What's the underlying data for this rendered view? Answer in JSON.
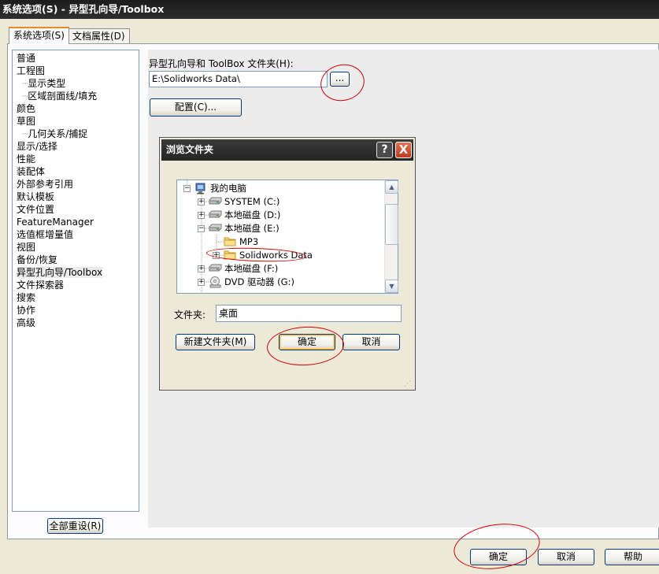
{
  "window": {
    "title": "系统选项(S) - 异型孔向导/Toolbox"
  },
  "tabs": [
    {
      "label": "系统选项(S)",
      "active": true
    },
    {
      "label": "文档属性(D)",
      "active": false
    }
  ],
  "tree": {
    "items": [
      {
        "label": "普通",
        "level": 0
      },
      {
        "label": "工程图",
        "level": 0
      },
      {
        "label": "显示类型",
        "level": 1
      },
      {
        "label": "区域剖面线/填充",
        "level": 1
      },
      {
        "label": "颜色",
        "level": 0
      },
      {
        "label": "草图",
        "level": 0
      },
      {
        "label": "几何关系/捕捉",
        "level": 1
      },
      {
        "label": "显示/选择",
        "level": 0
      },
      {
        "label": "性能",
        "level": 0
      },
      {
        "label": "装配体",
        "level": 0
      },
      {
        "label": "外部参考引用",
        "level": 0
      },
      {
        "label": "默认模板",
        "level": 0
      },
      {
        "label": "文件位置",
        "level": 0
      },
      {
        "label": "FeatureManager",
        "level": 0
      },
      {
        "label": "选值框增量值",
        "level": 0
      },
      {
        "label": "视图",
        "level": 0
      },
      {
        "label": "备份/恢复",
        "level": 0
      },
      {
        "label": "异型孔向导/Toolbox",
        "level": 0,
        "selected": true
      },
      {
        "label": "文件探索器",
        "level": 0
      },
      {
        "label": "搜索",
        "level": 0
      },
      {
        "label": "协作",
        "level": 0
      },
      {
        "label": "高级",
        "level": 0
      }
    ]
  },
  "toolbox": {
    "folder_label": "异型孔向导和 ToolBox 文件夹(H):",
    "folder_value": "E:\\Solidworks Data\\",
    "browse_label": "...",
    "configure_label": "配置(C)..."
  },
  "reset_all_label": "全部重设(R)",
  "bottom_buttons": {
    "ok": "确定",
    "cancel": "取消",
    "help": "帮助"
  },
  "browse_dialog": {
    "title": "浏览文件夹",
    "help_glyph": "?",
    "close_glyph": "X",
    "tree": [
      {
        "label": "我的电脑",
        "icon": "computer-icon",
        "expander": "-"
      },
      {
        "label": "SYSTEM (C:)",
        "icon": "drive-icon",
        "expander": "+"
      },
      {
        "label": "本地磁盘 (D:)",
        "icon": "drive-icon",
        "expander": "+"
      },
      {
        "label": "本地磁盘 (E:)",
        "icon": "drive-icon",
        "expander": "-"
      },
      {
        "label": "MP3",
        "icon": "folder-icon",
        "expander": ""
      },
      {
        "label": "Solidworks Data",
        "icon": "folder-icon",
        "expander": "+"
      },
      {
        "label": "本地磁盘 (F:)",
        "icon": "drive-icon",
        "expander": "+"
      },
      {
        "label": "DVD 驱动器 (G:)",
        "icon": "dvd-icon",
        "expander": "+"
      }
    ],
    "folder_label": "文件夹:",
    "folder_value": "桌面",
    "new_folder_label": "新建文件夹(M)",
    "ok_label": "确定",
    "cancel_label": "取消"
  },
  "colors": {
    "annotation": "#d10000",
    "tab_accent": "#e68b2c",
    "title_bar": "#1c1c1c"
  }
}
